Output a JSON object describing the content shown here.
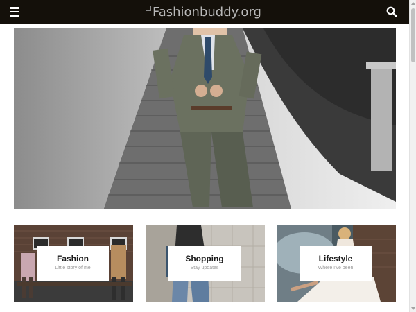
{
  "header": {
    "logo_alt": "Fashionbuddy.org",
    "bg_color": "#14100a",
    "menu_icon": "hamburger-menu-icon",
    "search_icon": "search-icon"
  },
  "hero": {
    "slide_count": 5,
    "active_slide": 1
  },
  "cards": [
    {
      "title": "Fashion",
      "subtitle": "Little story of me"
    },
    {
      "title": "Shopping",
      "subtitle": "Stay updates"
    },
    {
      "title": "Lifestyle",
      "subtitle": "Where I've been"
    }
  ]
}
